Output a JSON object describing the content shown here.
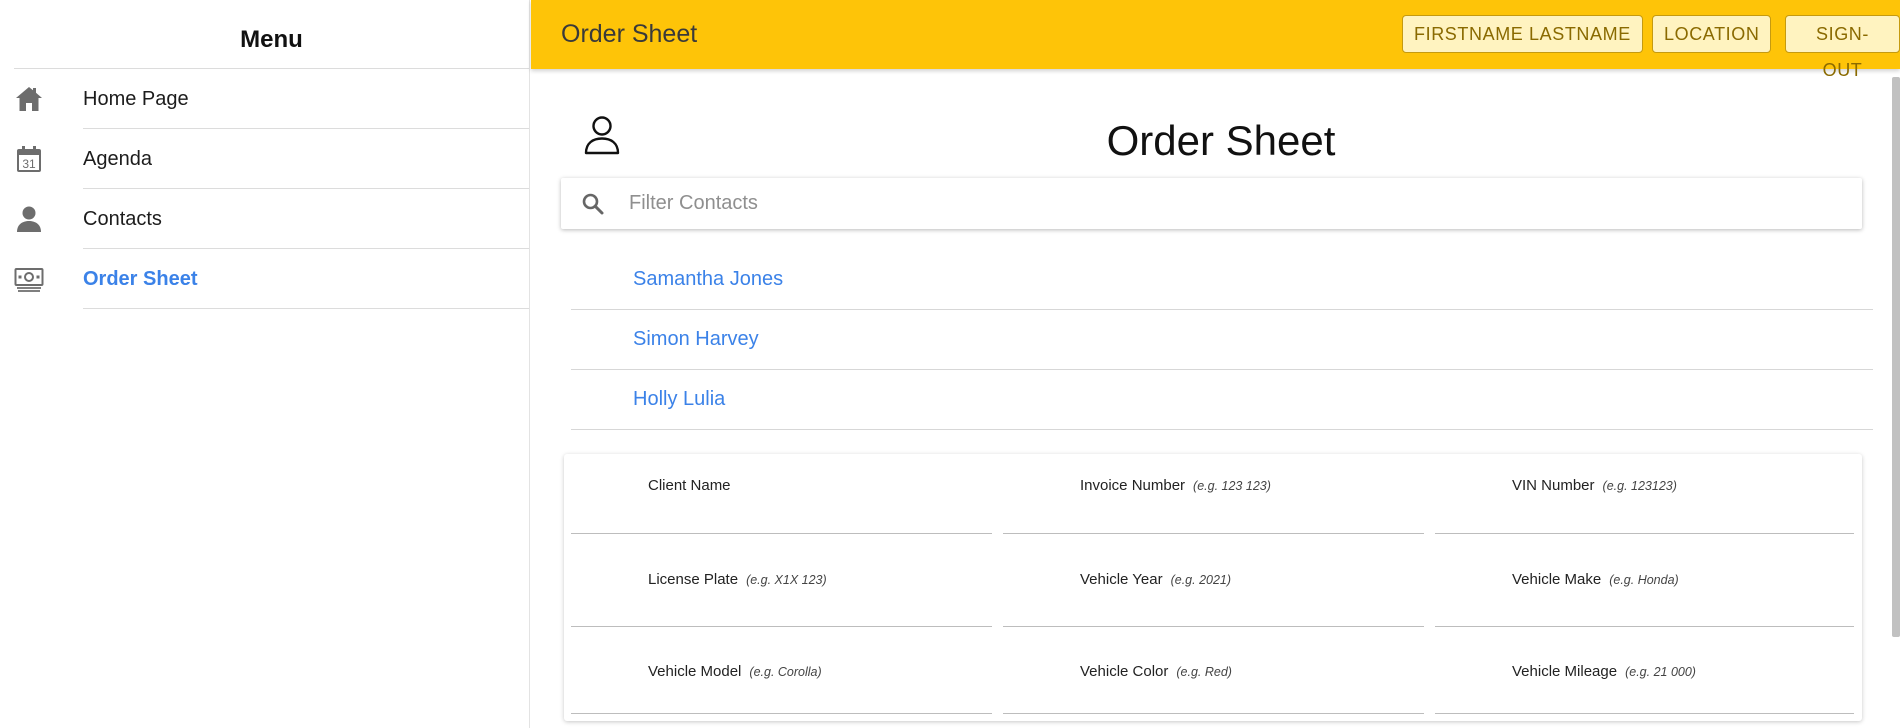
{
  "sidebar": {
    "title": "Menu",
    "items": [
      {
        "label": "Home Page",
        "icon": "home-icon",
        "active": false
      },
      {
        "label": "Agenda",
        "icon": "calendar-icon",
        "calendar_day": "31",
        "active": false
      },
      {
        "label": "Contacts",
        "icon": "person-icon",
        "active": false
      },
      {
        "label": "Order Sheet",
        "icon": "money-icon",
        "active": true
      }
    ]
  },
  "topbar": {
    "title": "Order Sheet",
    "buttons": {
      "user": "FIRSTNAME LASTNAME",
      "location": "LOCATION",
      "signout": "SIGN-OUT"
    },
    "color": "#fec408"
  },
  "main": {
    "heading": "Order Sheet",
    "search": {
      "placeholder": "Filter Contacts",
      "value": ""
    },
    "contacts": [
      "Samantha Jones",
      "Simon Harvey",
      "Holly Lulia"
    ],
    "form": {
      "client_name": {
        "label": "Client Name",
        "hint": ""
      },
      "invoice_number": {
        "label": "Invoice Number",
        "hint": "(e.g. 123 123)"
      },
      "vin_number": {
        "label": "VIN Number",
        "hint": "(e.g. 123123)"
      },
      "license_plate": {
        "label": "License Plate",
        "hint": "(e.g. X1X 123)"
      },
      "vehicle_year": {
        "label": "Vehicle Year",
        "hint": "(e.g. 2021)"
      },
      "vehicle_make": {
        "label": "Vehicle Make",
        "hint": "(e.g. Honda)"
      },
      "vehicle_model": {
        "label": "Vehicle Model",
        "hint": "(e.g. Corolla)"
      },
      "vehicle_color": {
        "label": "Vehicle Color",
        "hint": "(e.g. Red)"
      },
      "vehicle_mileage": {
        "label": "Vehicle Mileage",
        "hint": "(e.g. 21 000)"
      }
    }
  },
  "colors": {
    "accent": "#3b82e8",
    "topbar": "#fec408"
  }
}
